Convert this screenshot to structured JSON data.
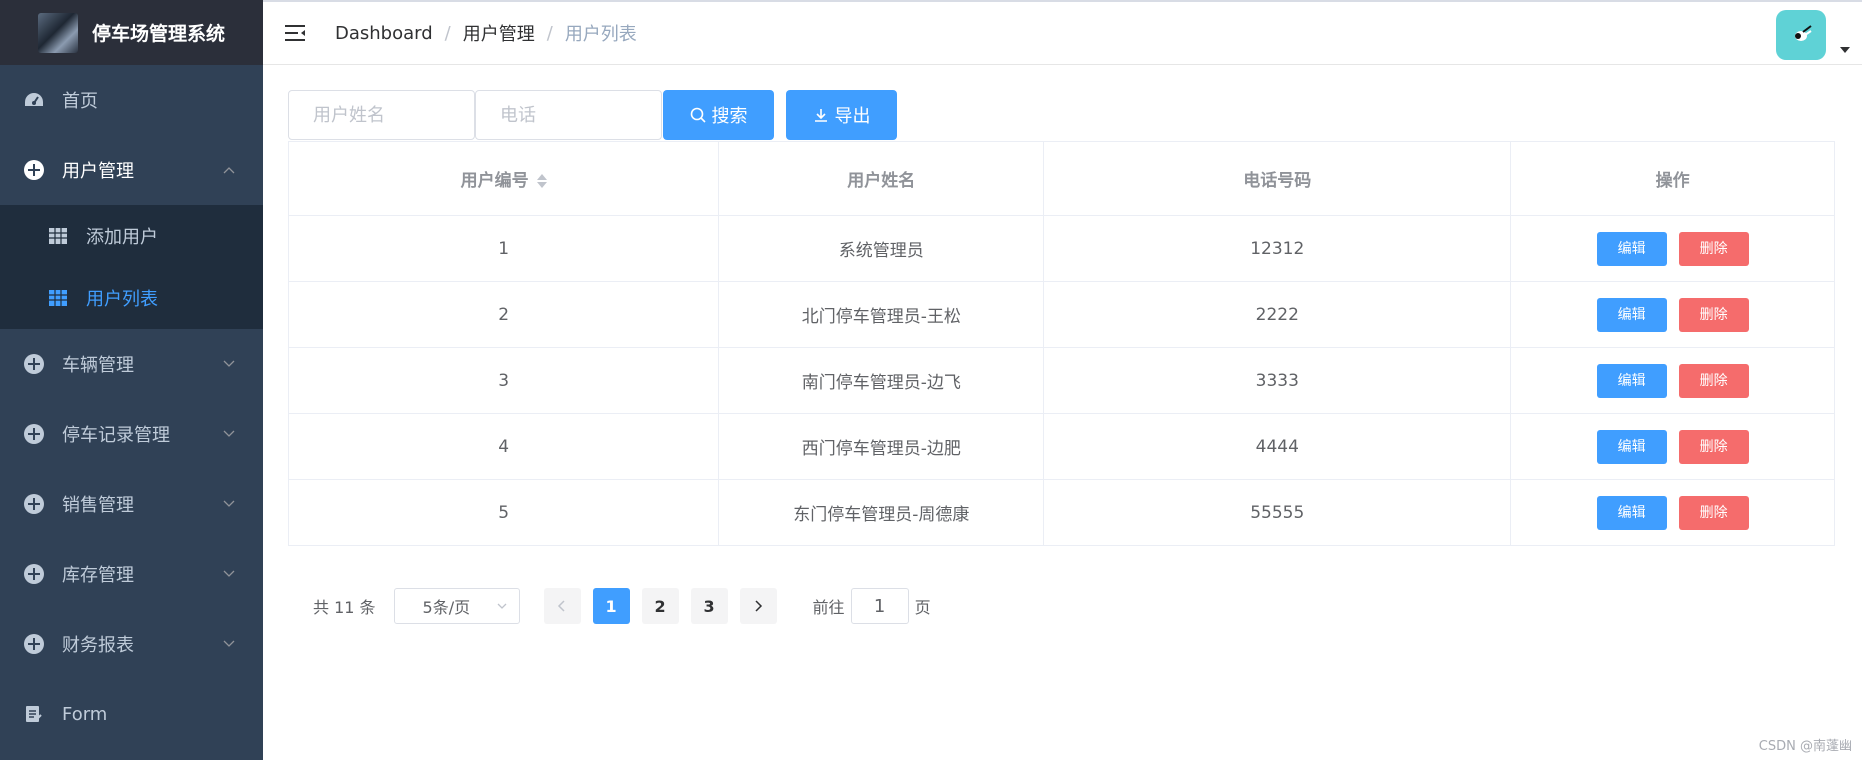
{
  "app": {
    "title": "停车场管理系统"
  },
  "sidebar": {
    "items": [
      {
        "label": "首页",
        "icon": "dashboard-icon"
      },
      {
        "label": "用户管理",
        "icon": "circle-plus-icon",
        "open": true,
        "children": [
          {
            "label": "添加用户",
            "icon": "table-icon"
          },
          {
            "label": "用户列表",
            "icon": "table-icon",
            "active": true
          }
        ]
      },
      {
        "label": "车辆管理",
        "icon": "circle-plus-icon"
      },
      {
        "label": "停车记录管理",
        "icon": "circle-plus-icon"
      },
      {
        "label": "销售管理",
        "icon": "circle-plus-icon"
      },
      {
        "label": "库存管理",
        "icon": "circle-plus-icon"
      },
      {
        "label": "财务报表",
        "icon": "circle-plus-icon"
      },
      {
        "label": "Form",
        "icon": "form-icon"
      }
    ]
  },
  "header": {
    "breadcrumb": [
      "Dashboard",
      "用户管理",
      "用户列表"
    ],
    "separator": "/"
  },
  "filter": {
    "name_placeholder": "用户姓名",
    "phone_placeholder": "电话",
    "search_label": "搜索",
    "export_label": "导出"
  },
  "table": {
    "columns": [
      "用户编号",
      "用户姓名",
      "电话号码",
      "操作"
    ],
    "rows": [
      {
        "id": "1",
        "name": "系统管理员",
        "phone": "12312"
      },
      {
        "id": "2",
        "name": "北门停车管理员-王松",
        "phone": "2222"
      },
      {
        "id": "3",
        "name": "南门停车管理员-边飞",
        "phone": "3333"
      },
      {
        "id": "4",
        "name": "西门停车管理员-边肥",
        "phone": "4444"
      },
      {
        "id": "5",
        "name": "东门停车管理员-周德康",
        "phone": "55555"
      }
    ],
    "edit_label": "编辑",
    "delete_label": "删除"
  },
  "pagination": {
    "total_text": "共 11 条",
    "page_size": "5条/页",
    "pages": [
      "1",
      "2",
      "3"
    ],
    "current": "1",
    "goto_prefix": "前往",
    "goto_value": "1",
    "goto_suffix": "页"
  },
  "watermark": "CSDN @南蓬幽",
  "colors": {
    "primary": "#409eff",
    "danger": "#f56c6c",
    "sidebar": "#304156",
    "avatar": "#5fd2d6"
  }
}
